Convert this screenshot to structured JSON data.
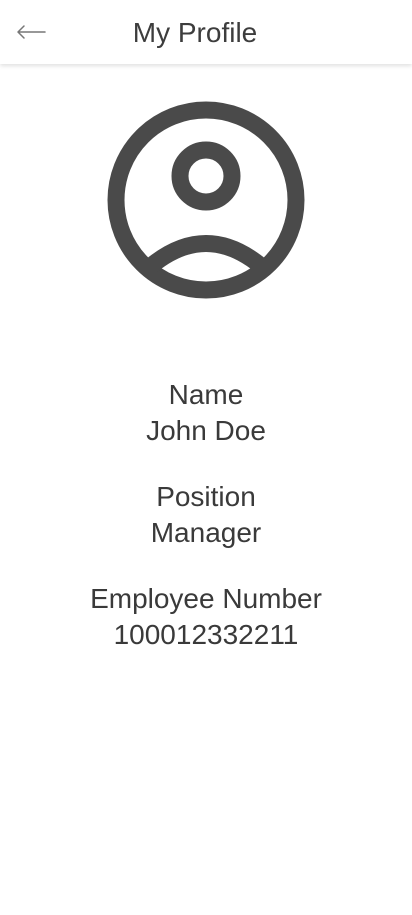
{
  "header": {
    "title": "My Profile",
    "back_icon": "arrow-left-icon"
  },
  "avatar": {
    "icon": "account-circle-icon",
    "color": "#4a4a4a"
  },
  "profile": {
    "name_label": "Name",
    "name_value": "John Doe",
    "position_label": "Position",
    "position_value": "Manager",
    "employee_number_label": "Employee Number",
    "employee_number_value": "100012332211"
  }
}
